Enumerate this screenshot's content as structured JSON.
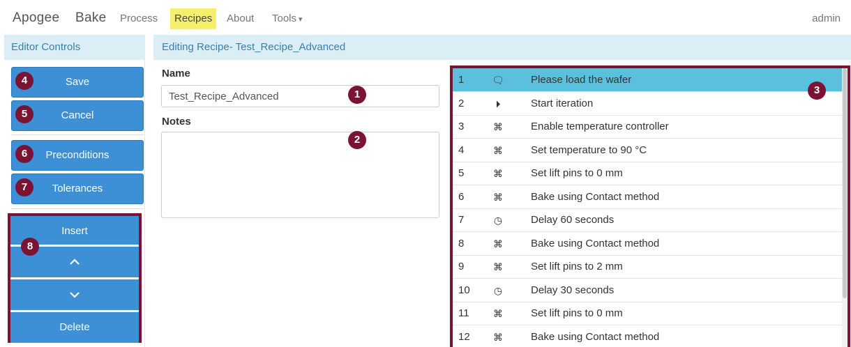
{
  "nav": {
    "brand_apogee": "Apogee",
    "brand_bake": "Bake",
    "process": "Process",
    "recipes": "Recipes",
    "about": "About",
    "tools": "Tools",
    "user": "admin"
  },
  "left": {
    "header": "Editor Controls",
    "save": "Save",
    "cancel": "Cancel",
    "preconditions": "Preconditions",
    "tolerances": "Tolerances",
    "insert": "Insert",
    "delete": "Delete"
  },
  "main": {
    "header": "Editing Recipe- Test_Recipe_Advanced",
    "name_label": "Name",
    "name_value": "Test_Recipe_Advanced",
    "notes_label": "Notes",
    "notes_value": ""
  },
  "badges": [
    "1",
    "2",
    "3",
    "4",
    "5",
    "6",
    "7",
    "8"
  ],
  "steps": [
    {
      "num": "1",
      "icon": "comment-icon",
      "glyph": "🗨",
      "text": "Please load the wafer",
      "selected": true
    },
    {
      "num": "2",
      "icon": "play-circle-icon",
      "glyph": "⏵",
      "text": "Start iteration"
    },
    {
      "num": "3",
      "icon": "command-icon",
      "glyph": "⌘",
      "text": "Enable temperature controller"
    },
    {
      "num": "4",
      "icon": "command-icon",
      "glyph": "⌘",
      "text": "Set temperature to 90 °C"
    },
    {
      "num": "5",
      "icon": "command-icon",
      "glyph": "⌘",
      "text": "Set lift pins to 0 mm"
    },
    {
      "num": "6",
      "icon": "command-icon",
      "glyph": "⌘",
      "text": "Bake using Contact method"
    },
    {
      "num": "7",
      "icon": "clock-icon",
      "glyph": "◷",
      "text": "Delay 60 seconds"
    },
    {
      "num": "8",
      "icon": "command-icon",
      "glyph": "⌘",
      "text": "Bake using Contact method"
    },
    {
      "num": "9",
      "icon": "command-icon",
      "glyph": "⌘",
      "text": "Set lift pins to 2 mm"
    },
    {
      "num": "10",
      "icon": "clock-icon",
      "glyph": "◷",
      "text": "Delay 30 seconds"
    },
    {
      "num": "11",
      "icon": "command-icon",
      "glyph": "⌘",
      "text": "Set lift pins to 0 mm"
    },
    {
      "num": "12",
      "icon": "command-icon",
      "glyph": "⌘",
      "text": "Bake using Contact method"
    }
  ],
  "colors": {
    "accent": "#3d8fd6",
    "highlight": "#f4f06b",
    "selected_row": "#5bc0de",
    "callout": "#7b1432",
    "header_bg": "#dbeef6"
  }
}
